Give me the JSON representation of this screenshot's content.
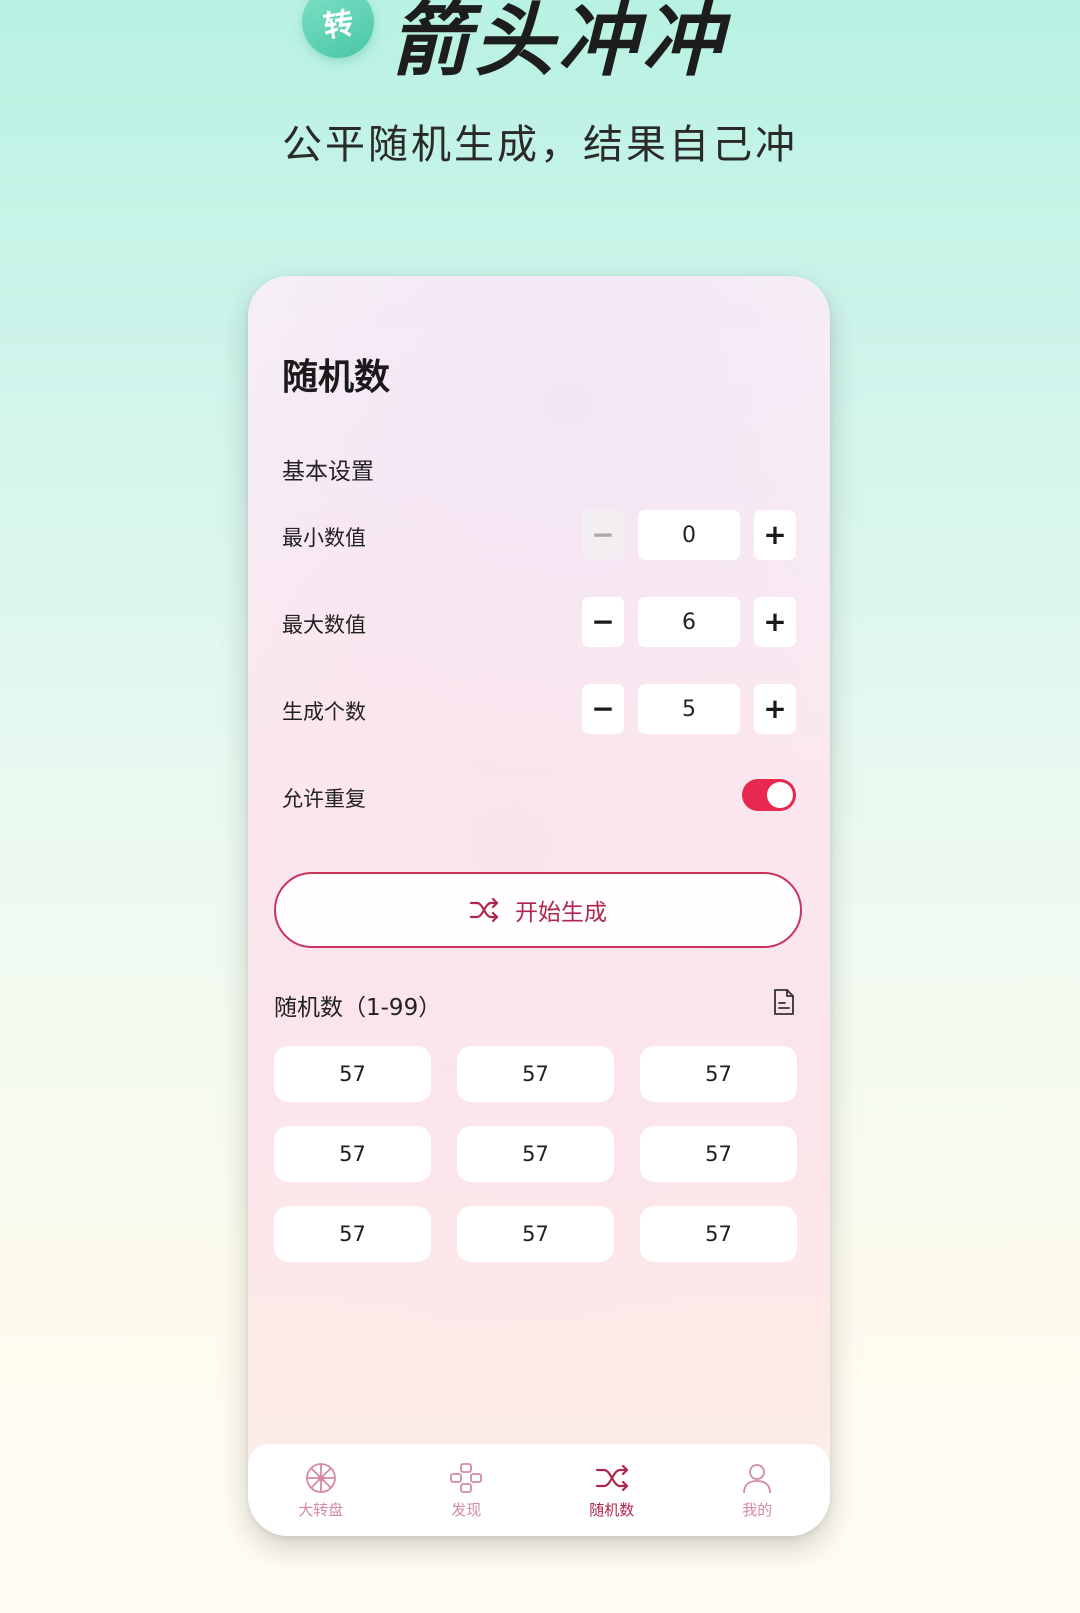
{
  "promo": {
    "badge": "转",
    "title": "箭头冲冲",
    "subtitle": "公平随机生成，结果自己冲"
  },
  "screen": {
    "title": "随机数",
    "section": "基本设置"
  },
  "settings": {
    "min": {
      "label": "最小数值",
      "value": "0",
      "minus": "−",
      "plus": "+"
    },
    "max": {
      "label": "最大数值",
      "value": "6",
      "minus": "−",
      "plus": "+"
    },
    "count": {
      "label": "生成个数",
      "value": "5",
      "minus": "−",
      "plus": "+"
    },
    "repeat": {
      "label": "允许重复",
      "enabled": true
    }
  },
  "generate_button": {
    "label": "开始生成",
    "icon": "shuffle-icon"
  },
  "results": {
    "title": "随机数（1-99）",
    "icon": "document-icon",
    "values": [
      "57",
      "57",
      "57",
      "57",
      "57",
      "57",
      "57",
      "57",
      "57"
    ]
  },
  "nav": {
    "items": [
      {
        "label": "大转盘",
        "icon": "wheel-icon",
        "active": false
      },
      {
        "label": "发现",
        "icon": "gamepad-icon",
        "active": false
      },
      {
        "label": "随机数",
        "icon": "shuffle-icon",
        "active": true
      },
      {
        "label": "我的",
        "icon": "user-icon",
        "active": false
      }
    ]
  },
  "colors": {
    "accent": "#b0264c",
    "toggle_on": "#e8294f",
    "nav_inactive": "#d58aa0"
  }
}
